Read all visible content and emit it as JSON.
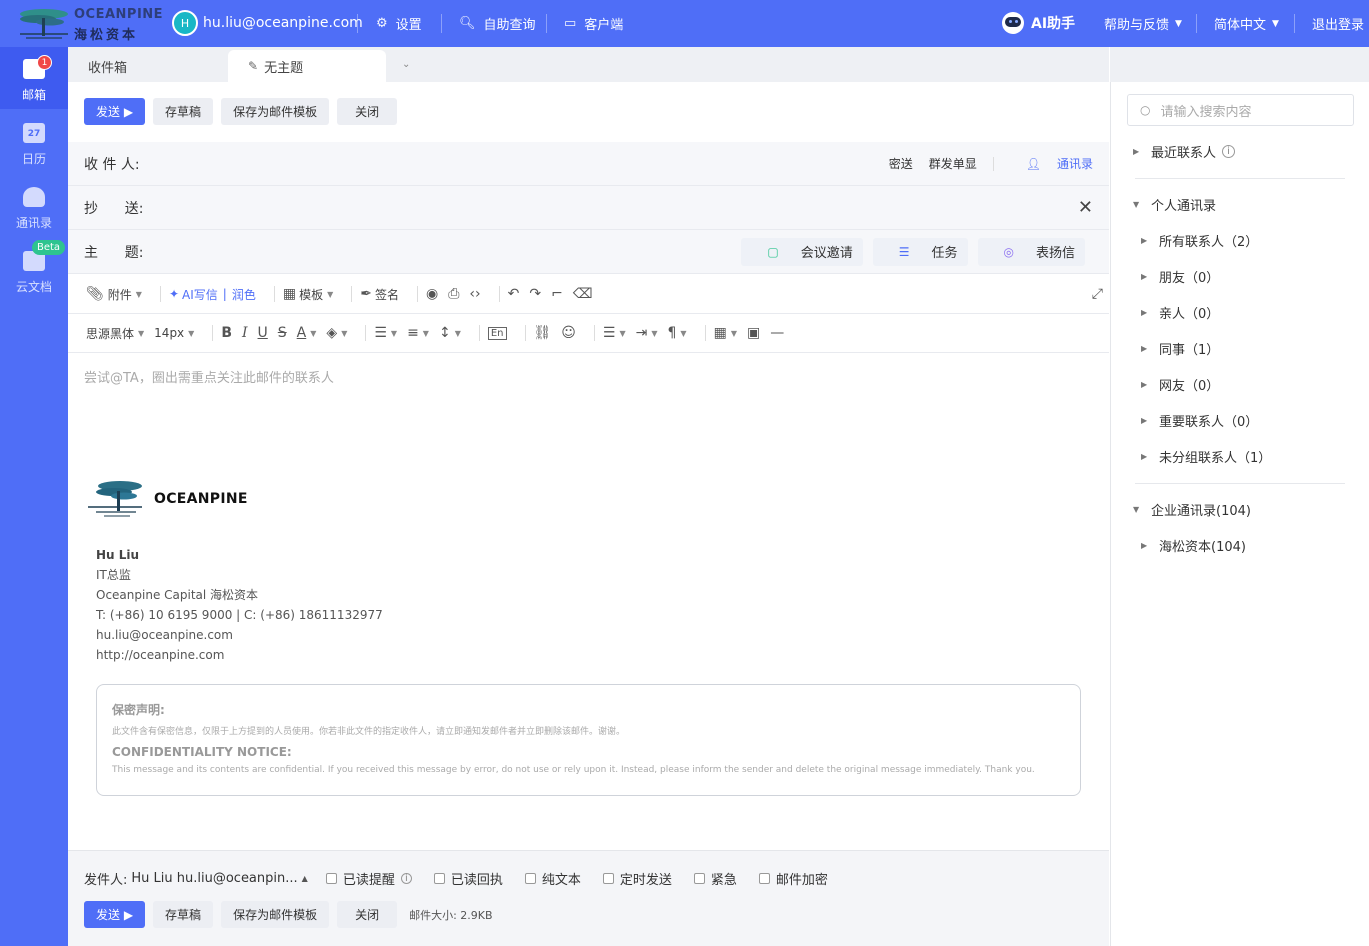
{
  "header": {
    "logo_en": "OCEANPINE",
    "logo_cn": "海松资本",
    "avatar_letter": "H",
    "user_email": "hu.liu@oceanpine.com",
    "nav": [
      {
        "label": "设置",
        "icon": "gear-icon"
      },
      {
        "label": "自助查询",
        "icon": "search-doc-icon"
      },
      {
        "label": "客户端",
        "icon": "monitor-icon"
      }
    ],
    "ai_label": "AI助手",
    "help_label": "帮助与反馈",
    "lang_label": "简体中文",
    "logout_label": "退出登录"
  },
  "sidebar": {
    "items": [
      {
        "label": "邮箱",
        "badge": "1"
      },
      {
        "label": "日历",
        "icon_text": "27"
      },
      {
        "label": "通讯录"
      },
      {
        "label": "云文档",
        "badge": "Beta"
      }
    ]
  },
  "tabs": {
    "inbox": "收件箱",
    "draft": "无主题"
  },
  "compose": {
    "send": "发送 ▶",
    "save_draft": "存草稿",
    "save_template": "保存为邮件模板",
    "close": "关闭",
    "to_label": "收 件 人:",
    "bcc": "密送",
    "single_display": "群发单显",
    "contacts_link": "通讯录",
    "cc_label": "抄      送:",
    "subject_label": "主      题:",
    "chips": [
      "会议邀请",
      "任务",
      "表扬信"
    ],
    "toolbar1": {
      "attach": "附件",
      "ai_write": "AI写信",
      "polish": "润色",
      "template": "模板",
      "signature": "签名"
    },
    "font_family": "思源黑体",
    "font_size": "14px",
    "placeholder": "尝试@TA，圈出需重点关注此邮件的联系人"
  },
  "signature": {
    "brand": "OCEANPINE",
    "name": "Hu Liu",
    "title": "IT总监",
    "company": "Oceanpine Capital 海松资本",
    "phone": "T: (+86) 10 6195 9000 | C: (+86) 18611132977",
    "email": "hu.liu@oceanpine.com",
    "web": "http://oceanpine.com",
    "notice_cn_title": "保密声明:",
    "notice_cn": "此文件含有保密信息，仅限于上方提到的人员使用。你若非此文件的指定收件人，请立即通知发邮件者并立即删除该邮件。谢谢。",
    "notice_en_title": "CONFIDENTIALITY NOTICE:",
    "notice_en": "This message and its contents are confidential. If you received this message by error, do not use or rely upon it. Instead, please inform the sender and delete the original message immediately. Thank you."
  },
  "footer": {
    "sender_label": "发件人:",
    "sender_value": "Hu Liu hu.liu@oceanpin...",
    "options": [
      "已读提醒",
      "已读回执",
      "纯文本",
      "定时发送",
      "紧急",
      "邮件加密"
    ],
    "size_label": "邮件大小: 2.9KB"
  },
  "contacts_panel": {
    "search_placeholder": "请输入搜索内容",
    "recent": "最近联系人",
    "personal": "个人通讯录",
    "groups": [
      "所有联系人（2）",
      "朋友（0）",
      "亲人（0）",
      "同事（1）",
      "网友（0）",
      "重要联系人（0）",
      "未分组联系人（1）"
    ],
    "enterprise": "企业通讯录(104)",
    "enterprise_groups": [
      "海松资本(104)"
    ]
  },
  "colors": {
    "brand": "#4f6ef7",
    "badge_red": "#f04848",
    "beta_green": "#2ec48f",
    "avatar": "#19b7c6"
  }
}
